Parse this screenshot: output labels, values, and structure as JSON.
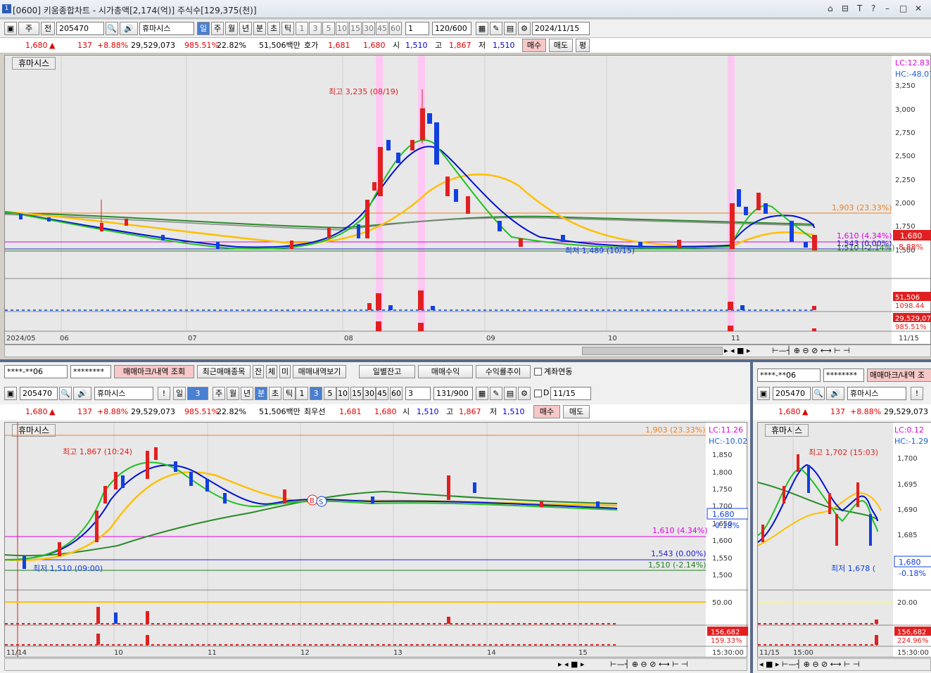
{
  "window": {
    "title": "[0600] 키움종합차트 - 시가총액[2,174(억)] 주식수[129,375(천)]",
    "controls": [
      "⌂",
      "⊟",
      "T",
      "?",
      "–",
      "□",
      "✕"
    ]
  },
  "top": {
    "toolbar": {
      "period_sel": "주",
      "period2": "전",
      "code": "205470",
      "name": "휴마시스",
      "tf_tabs": [
        "일",
        "주",
        "월",
        "년",
        "분",
        "초",
        "틱"
      ],
      "nums": [
        "1",
        "3",
        "5",
        "10",
        "15",
        "30",
        "45",
        "60"
      ],
      "count_sel": "1",
      "count": "120/600",
      "date": "2024/11/15"
    },
    "quote": {
      "price": "1,680",
      "arrow": "▲",
      "change": "137",
      "rate": "+8.88%",
      "volume": "29,529,073",
      "vol_ratio": "985.51%",
      "turnover": "22.82%",
      "amount": "51,506백만",
      "hoga_label": "호가",
      "ask": "1,681",
      "bid": "1,680",
      "open_label": "시",
      "open": "1,510",
      "high_label": "고",
      "high": "1,867",
      "low_label": "저",
      "low": "1,510",
      "buy": "매수",
      "sell": "매도",
      "flat": "평"
    },
    "chart": {
      "name": "휴마시스",
      "lc": "LC:12.83",
      "hc": "HC:-48.07",
      "yticks": [
        "3,250",
        "3,000",
        "2,750",
        "2,500",
        "2,250",
        "2,000",
        "1,750",
        "1,500"
      ],
      "high_note": "최고 3,235 (08/19)",
      "low_note": "최저 1,489 (10/15)",
      "line1": "1,903 (23.33%)",
      "line2": "1,610 (4.34%)",
      "line3": "1,543 (0.00%)",
      "line4": "1,510 (-2.14%)",
      "price_tag": "1,680",
      "rate_tag": "8.88%",
      "vol_tag": "51,506",
      "vol_tag2": "1098.44",
      "vol2_tag": "29,529,07",
      "vol2_tag2": "985.51%",
      "xlabels": [
        "2024/05",
        "06",
        "07",
        "08",
        "09",
        "10",
        "11"
      ],
      "xend": "11/15"
    }
  },
  "bl": {
    "acct": {
      "acc": "****-**06",
      "pw": "********",
      "b1": "매매마크/내역 조회",
      "b2": "최근매매종목",
      "b3": "잔",
      "b4": "체",
      "b5": "미",
      "b6": "매매내역보기",
      "b7": "일별잔고",
      "b8": "매매수익",
      "b9": "수익률추이",
      "chk": "계좌연동"
    },
    "toolbar": {
      "code": "205470",
      "name": "휴마시스",
      "min": "3",
      "tf_tabs": [
        "일",
        "분",
        "주",
        "월",
        "년",
        "분",
        "초",
        "틱"
      ],
      "nums": [
        "1",
        "3",
        "5",
        "10",
        "15",
        "30",
        "45",
        "60"
      ],
      "cnt": "3",
      "count": "131/900",
      "date": "11/15",
      "d": "D"
    },
    "quote": {
      "price": "1,680",
      "arrow": "▲",
      "change": "137",
      "rate": "+8.88%",
      "volume": "29,529,073",
      "vol_ratio": "985.51%",
      "turnover": "22.82%",
      "amount": "51,506백만",
      "lbl": "최우선",
      "ask": "1,681",
      "bid": "1,680",
      "open_label": "시",
      "open": "1,510",
      "high_label": "고",
      "high": "1,867",
      "low_label": "저",
      "low": "1,510",
      "buy": "매수",
      "sell": "매도"
    },
    "chart": {
      "name": "휴마시스",
      "lc": "LC:11.26",
      "hc": "HC:-10.02",
      "yticks": [
        "1,850",
        "1,800",
        "1,750",
        "1,700",
        "1,650",
        "1,600",
        "1,550",
        "1,500"
      ],
      "high_note": "최고 1,867 (10:24)",
      "low_note": "최저 1,510 (09:00)",
      "line1": "1,903 (23.33%)",
      "line2": "1,610 (4.34%)",
      "line3": "1,543 (0.00%)",
      "line4": "1,510 (-2.14%)",
      "price_tag": "1,680",
      "rate_tag": "-0.18%",
      "vol_tick": "50.00",
      "vol_tag": "156,682",
      "vol_tag2": "159.33%",
      "xlabels": [
        "11/14",
        "10",
        "11",
        "12",
        "13",
        "14",
        "15"
      ],
      "xend": "15:30:00",
      "b": "B",
      "s": "S"
    }
  },
  "br": {
    "acct": {
      "acc": "****-**06",
      "pw": "********",
      "b1": "매매마크/내역 조"
    },
    "toolbar": {
      "code": "205470",
      "name": "휴마시스"
    },
    "quote": {
      "price": "1,680",
      "arrow": "▲",
      "change": "137",
      "rate": "+8.88%",
      "volume": "29,529,073"
    },
    "chart": {
      "name": "휴마시스",
      "lc": "LC:0.12",
      "hc": "HC:-1.29",
      "yticks": [
        "1,700",
        "1,695",
        "1,690",
        "1,685"
      ],
      "high_note": "최고 1,702 (15:03)",
      "low_note": "최저 1,678 (",
      "price_tag": "1,680",
      "rate_tag": "-0.18%",
      "vol_tick": "20.00",
      "vol_tag": "156,682",
      "vol_tag2": "224.96%",
      "xlabels": [
        "11/15",
        "15:00"
      ],
      "xend": "15:30:00"
    }
  }
}
